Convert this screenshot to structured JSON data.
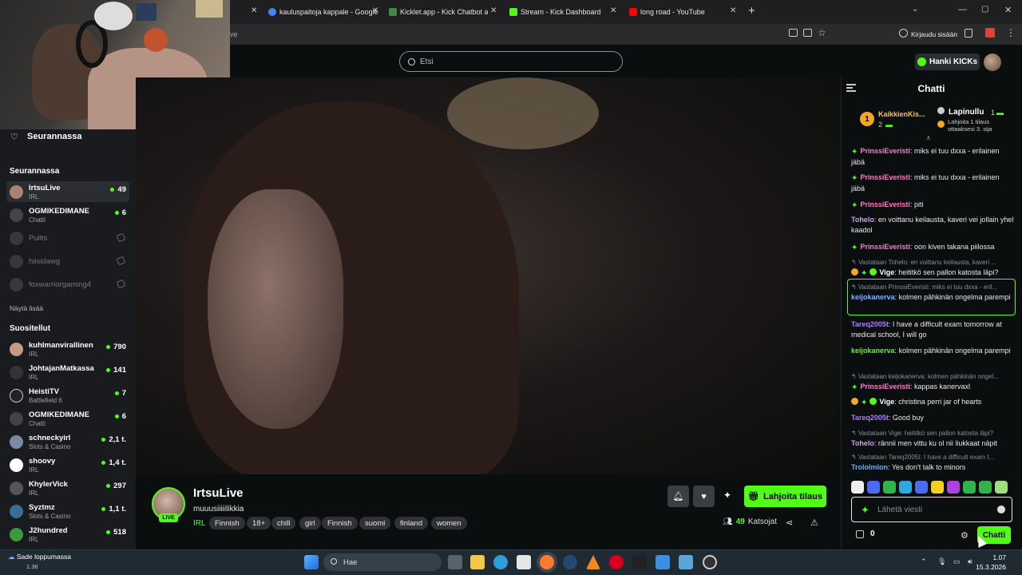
{
  "browser": {
    "tabs": [
      {
        "title": "kauluspaitoja kappale - Google",
        "color": "#4285f4"
      },
      {
        "title": "Kicklet.app - Kick Chatbot and C",
        "color": "#3a8c3f"
      },
      {
        "title": "Stream - Kick Dashboard",
        "color": "#53fc18"
      },
      {
        "title": "long road - YouTube",
        "color": "#ff0000"
      }
    ],
    "new_tab_label": "+",
    "address_partial": "ve",
    "signin_label": "Kirjaudu sisään"
  },
  "header": {
    "search_placeholder": "Etsi",
    "kicks_label": "Hanki KICKs"
  },
  "sidebar": {
    "following_heading": "Seurannassa",
    "following_section": "Seurannassa",
    "show_more": "Näytä lisää",
    "recommended_section": "Suositellut",
    "following": [
      {
        "name": "IrtsuLive",
        "sub": "IRL",
        "viewers": "49",
        "live": true
      },
      {
        "name": "OGMIKEDIMANE",
        "sub": "Chatti",
        "viewers": "6",
        "live": true
      },
      {
        "name": "Pullts",
        "sub": "",
        "viewers": "",
        "live": false
      },
      {
        "name": "hiisidawg",
        "sub": "",
        "viewers": "",
        "live": false
      },
      {
        "name": "foxwarriorgaming4",
        "sub": "",
        "viewers": "",
        "live": false
      }
    ],
    "recommended": [
      {
        "name": "kuhlmanvirallinen",
        "sub": "IRL",
        "viewers": "790"
      },
      {
        "name": "JohtajanMatkassa",
        "sub": "IRL",
        "viewers": "141"
      },
      {
        "name": "HeistiTV",
        "sub": "Battlefield 6",
        "viewers": "7"
      },
      {
        "name": "OGMIKEDIMANE",
        "sub": "Chatti",
        "viewers": "6"
      },
      {
        "name": "schneckyirl",
        "sub": "Slots & Casino",
        "viewers": "2,1 t."
      },
      {
        "name": "shoovy",
        "sub": "IRL",
        "viewers": "1,4 t."
      },
      {
        "name": "KhylerVick",
        "sub": "IRL",
        "viewers": "297"
      },
      {
        "name": "Syztmz",
        "sub": "Slots & Casino",
        "viewers": "1,1 t."
      },
      {
        "name": "J2hundred",
        "sub": "IRL",
        "viewers": "518"
      }
    ]
  },
  "stream": {
    "streamer": "IrtsuLive",
    "title": "muuusiiiiilikkia",
    "live_badge": "LIVE",
    "category": "IRL",
    "tags": [
      "Finnish",
      "18+",
      "chill",
      "girl",
      "Finnish",
      "suomi",
      "finland",
      "women"
    ],
    "gift_label": "Lahjoita tilaus",
    "viewers": "49",
    "viewers_label": "Katsojat"
  },
  "chat": {
    "title": "Chatti",
    "pinned": [
      {
        "rank": "1",
        "name": "KaikkienKis...",
        "count": "2"
      },
      {
        "name": "Lapinullu",
        "count": "1",
        "note": "Lahjoita 1 tilaus ottaaksesi 3. sija"
      }
    ],
    "messages": [
      {
        "user": "PrinssiEveristi",
        "color": "#ff7ac8",
        "text": "miks ei tuu dxxa - erilainen jäbä",
        "badge": "s"
      },
      {
        "user": "PrinssiEveristi",
        "color": "#ff7ac8",
        "text": "miks ei tuu dxxa - erilainen jäbä",
        "badge": "s"
      },
      {
        "user": "PrinssiEveristi",
        "color": "#ff7ac8",
        "text": "piti",
        "badge": "s"
      },
      {
        "user": "Tohelo",
        "color": "#c9a2ff",
        "text": "en voittanu keilausta, kaveri vei jollain yhel kaadol",
        "badge": ""
      },
      {
        "user": "PrinssiEveristi",
        "color": "#ff7ac8",
        "text": "oon kiven takana piilossa",
        "badge": "s"
      },
      {
        "reply": "Vastataan Tohelo: en voittanu keilausta, kaveri ...",
        "user": "Vige",
        "color": "#ffffff",
        "text": "heititkö sen pallon katosta läpi?",
        "badge": "o"
      },
      {
        "reply": "Vastataan PrinssiEveristi: miks ei tuu dxxa - eril...",
        "user": "keijokanerva",
        "color": "#7fb2ff",
        "text": "kolmen pähkinän ongelma parempi",
        "badge": ""
      },
      {
        "user": "Tareq2005t",
        "color": "#b27bff",
        "text": "I have a difficult exam tomorrow at medical school, I will go",
        "badge": ""
      },
      {
        "user": "keijokanerva",
        "color": "#53fc18",
        "text": "kolmen pähkinän ongelma parempi",
        "badge": ""
      },
      {
        "reply": "Vastataan keijokanerva: kolmen pähkinän ongel...",
        "user": "PrinssiEveristi",
        "color": "#ff7ac8",
        "text": "kappas kanervaxl",
        "badge": "s"
      },
      {
        "user": "Vige",
        "color": "#ffffff",
        "text": "christina perri jar of hearts",
        "badge": "o"
      },
      {
        "user": "Tareq2005t",
        "color": "#b27bff",
        "text": "Good buy",
        "badge": ""
      },
      {
        "reply": "Vastataan Vige: heititkö sen pallon katosta läpi?",
        "user": "Tohelo",
        "color": "#c9a2ff",
        "text": "rännii men vittu ku ol nii liukkaat näpit",
        "badge": ""
      },
      {
        "reply": "Vastataan Tareq2005t: I have a difficult exam t...",
        "user": "Trololmlon",
        "color": "#5fb0ff",
        "text": "Yes don't talk to minors",
        "badge": ""
      }
    ],
    "input_placeholder": "Lähetä viesti",
    "points": "0",
    "send_label": "Chatti"
  },
  "taskbar": {
    "weather": "Sade loppumassa",
    "weather_temp": "1.36",
    "search_placeholder": "Hae",
    "time": "1.07",
    "date": "15.3.2026"
  }
}
